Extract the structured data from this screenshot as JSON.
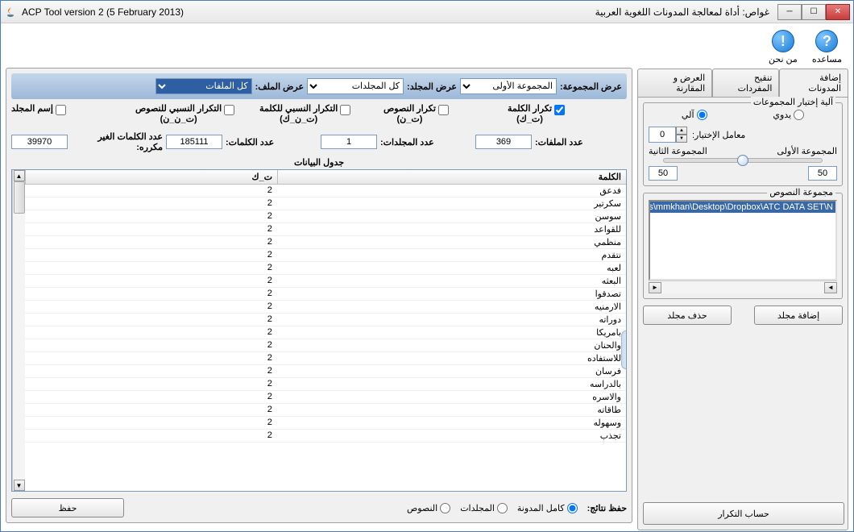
{
  "title_en": "ACP Tool version 2 (5 February 2013)",
  "title_ar": "غواص: أداة لمعالجة المدونات اللغوية العربية",
  "help": {
    "about": "من نحن",
    "help": "مساعده"
  },
  "tabs": {
    "add": "إضافة المدونات",
    "refine": "تنقيح المفردات",
    "compare": "العرض و المقارنة"
  },
  "group_select": {
    "legend": "آلية إختيار المجموعات",
    "manual": "يدوي",
    "auto": "آلي",
    "factor_label": "معامل الإختيار:",
    "factor_value": "0",
    "g1": "المجموعة الأولى",
    "g2": "المجموعة الثانية",
    "v1": "50",
    "v2": "50"
  },
  "texts_group": {
    "legend": "مجموعة النصوص",
    "path": "C:\\Users\\mmkhan\\Desktop\\Dropbox\\ATC DATA SET\\N"
  },
  "btns": {
    "add_folder": "إضافة مجلد",
    "del_folder": "حذف مجلد",
    "compute": "حساب التكرار",
    "save": "حفظ"
  },
  "dropdowns": {
    "group_label": "عرض المجموعة:",
    "group_value": "المجموعة الأولى",
    "folder_label": "عرض المجلد:",
    "folder_value": "كل المجلدات",
    "file_label": "عرض الملف:",
    "file_value": "كل الملفات"
  },
  "checks": {
    "c1a": "تكرار الكلمة",
    "c1b": "(ت_ك)",
    "c2a": "تكرار النصوص",
    "c2b": "(ت_ن)",
    "c3a": "التكرار النسبي للكلمة",
    "c3b": "(ت_ن_ك)",
    "c4a": "التكرار النسبي للنصوص",
    "c4b": "(ت_ن_ن)",
    "c5": "إسم المجلد"
  },
  "stats": {
    "files_label": "عدد الملفات:",
    "files_value": "369",
    "folders_label": "عدد المجلدات:",
    "folders_value": "1",
    "words_label": "عدد الكلمات:",
    "words_value": "185111",
    "unique_label": "عدد الكلمات الغير مكرره:",
    "unique_value": "39970"
  },
  "table": {
    "title": "جدول البيانات",
    "col_word": "الكلمة",
    "col_tk": "ت_ك",
    "rows": [
      {
        "w": "فدعق",
        "v": "2"
      },
      {
        "w": "سكرتير",
        "v": "2"
      },
      {
        "w": "سوسن",
        "v": "2"
      },
      {
        "w": "للقواعد",
        "v": "2"
      },
      {
        "w": "منظمي",
        "v": "2"
      },
      {
        "w": "نتقدم",
        "v": "2"
      },
      {
        "w": "لعبه",
        "v": "2"
      },
      {
        "w": "البعثه",
        "v": "2"
      },
      {
        "w": "تصدقوا",
        "v": "2"
      },
      {
        "w": "الارمنيه",
        "v": "2"
      },
      {
        "w": "دوراته",
        "v": "2"
      },
      {
        "w": "بامريكا",
        "v": "2"
      },
      {
        "w": "والحنان",
        "v": "2"
      },
      {
        "w": "للاستفاده",
        "v": "2"
      },
      {
        "w": "فرسان",
        "v": "2"
      },
      {
        "w": "بالدراسه",
        "v": "2"
      },
      {
        "w": "والاسره",
        "v": "2"
      },
      {
        "w": "طاقاته",
        "v": "2"
      },
      {
        "w": "وسهوله",
        "v": "2"
      },
      {
        "w": "تجذب",
        "v": "2"
      }
    ]
  },
  "save_results": {
    "label": "حفظ نتائج:",
    "opt_corpus": "كامل المدونة",
    "opt_folders": "المجلدات",
    "opt_texts": "النصوص"
  }
}
